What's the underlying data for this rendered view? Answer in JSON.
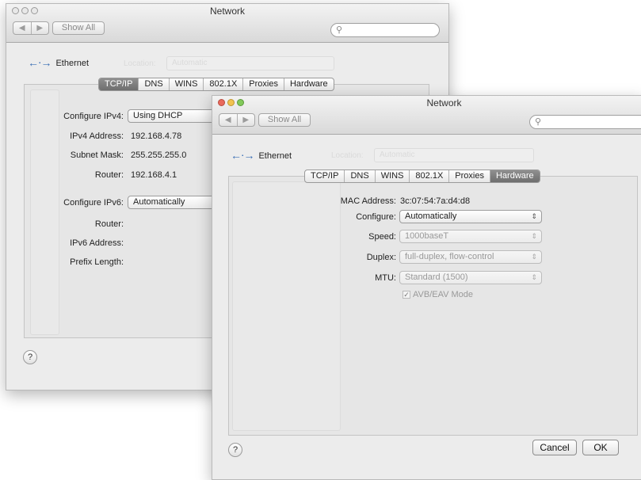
{
  "back": {
    "title": "Network",
    "nav_back": "◀",
    "nav_fwd": "▶",
    "show_all": "Show All",
    "search_placeholder": "",
    "interface": "Ethernet",
    "location_label": "Location:",
    "location_value": "Automatic",
    "tabs": [
      "TCP/IP",
      "DNS",
      "WINS",
      "802.1X",
      "Proxies",
      "Hardware"
    ],
    "selected_tab": "TCP/IP",
    "fields": {
      "configure_ipv4_label": "Configure IPv4:",
      "configure_ipv4_value": "Using DHCP",
      "ipv4_address_label": "IPv4 Address:",
      "ipv4_address_value": "192.168.4.78",
      "subnet_mask_label": "Subnet Mask:",
      "subnet_mask_value": "255.255.255.0",
      "router_label": "Router:",
      "router_value": "192.168.4.1",
      "configure_ipv6_label": "Configure IPv6:",
      "configure_ipv6_value": "Automatically",
      "router6_label": "Router:",
      "ipv6_address_label": "IPv6 Address:",
      "prefix_length_label": "Prefix Length:"
    },
    "help": "?"
  },
  "front": {
    "title": "Network",
    "nav_back": "◀",
    "nav_fwd": "▶",
    "show_all": "Show All",
    "search_placeholder": "",
    "interface": "Ethernet",
    "location_label": "Location:",
    "location_value": "Automatic",
    "tabs": [
      "TCP/IP",
      "DNS",
      "WINS",
      "802.1X",
      "Proxies",
      "Hardware"
    ],
    "selected_tab": "Hardware",
    "fields": {
      "mac_label": "MAC Address:",
      "mac_value": "3c:07:54:7a:d4:d8",
      "configure_label": "Configure:",
      "configure_value": "Automatically",
      "speed_label": "Speed:",
      "speed_value": "1000baseT",
      "duplex_label": "Duplex:",
      "duplex_value": "full-duplex, flow-control",
      "mtu_label": "MTU:",
      "mtu_value": "Standard (1500)",
      "avb_label": "AVB/EAV Mode",
      "avb_checked": true
    },
    "help": "?",
    "cancel": "Cancel",
    "ok": "OK"
  },
  "colors": {
    "window_bg": "#ececec",
    "selected_tab": "#7a7a7a",
    "ethernet_icon": "#3a6fb5"
  }
}
